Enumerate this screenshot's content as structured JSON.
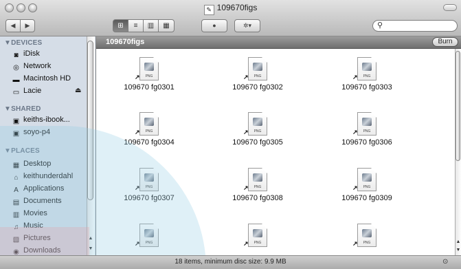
{
  "window": {
    "title": "109670figs",
    "title_icon": "document-icon"
  },
  "toolbar": {
    "back_label": "◀",
    "forward_label": "▶",
    "view_icon_label": "⊞",
    "view_list_label": "≡",
    "view_column_label": "▥",
    "view_coverflow_label": "▦",
    "quicklook_label": "●",
    "action_label": "✲▾",
    "search_placeholder": ""
  },
  "sidebar": {
    "devices_header": "▼DEVICES",
    "shared_header": "▼SHARED",
    "places_header": "▼PLACES",
    "devices": [
      {
        "label": "iDisk",
        "icon": "disk-icon"
      },
      {
        "label": "Network",
        "icon": "globe-icon"
      },
      {
        "label": "Macintosh HD",
        "icon": "drive-icon"
      },
      {
        "label": "Lacie",
        "icon": "drive-icon"
      }
    ],
    "shared": [
      {
        "label": "keiths-ibook...",
        "icon": "computer-icon"
      },
      {
        "label": "soyo-p4",
        "icon": "computer-icon"
      }
    ],
    "places": [
      {
        "label": "Desktop",
        "icon": "desktop-icon"
      },
      {
        "label": "keithunderdahl",
        "icon": "home-icon"
      },
      {
        "label": "Applications",
        "icon": "applications-icon"
      },
      {
        "label": "Documents",
        "icon": "documents-icon"
      },
      {
        "label": "Movies",
        "icon": "movies-icon"
      },
      {
        "label": "Music",
        "icon": "music-icon"
      },
      {
        "label": "Pictures",
        "icon": "pictures-icon"
      },
      {
        "label": "Downloads",
        "icon": "downloads-icon"
      }
    ]
  },
  "pathbar": {
    "folder_name": "109670figs",
    "burn_label": "Burn"
  },
  "files": [
    {
      "name": "109670 fg0301",
      "type": "PNG"
    },
    {
      "name": "109670 fg0302",
      "type": "PNG"
    },
    {
      "name": "109670 fg0303",
      "type": "PNG"
    },
    {
      "name": "109670 fg0304",
      "type": "PNG"
    },
    {
      "name": "109670 fg0305",
      "type": "PNG"
    },
    {
      "name": "109670 fg0306",
      "type": "PNG"
    },
    {
      "name": "109670 fg0307",
      "type": "PNG"
    },
    {
      "name": "109670 fg0308",
      "type": "PNG"
    },
    {
      "name": "109670 fg0309",
      "type": "PNG"
    },
    {
      "name": "",
      "type": "PNG"
    },
    {
      "name": "",
      "type": "PNG"
    },
    {
      "name": "",
      "type": "PNG"
    }
  ],
  "status": {
    "text": "18 items, minimum disc size: 9.9 MB"
  }
}
